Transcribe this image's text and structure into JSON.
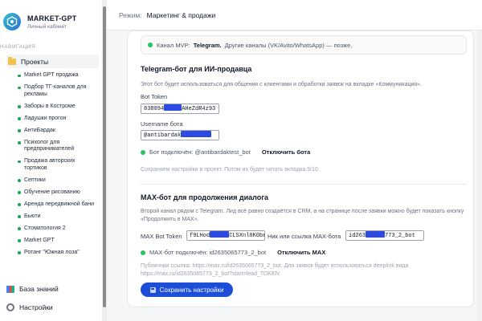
{
  "brand": {
    "title": "MARKET-GPT",
    "subtitle": "Личный кабинет"
  },
  "nav": {
    "heading": "НАВИГАЦИЯ",
    "projects_label": "Проекты",
    "projects": [
      "Market GPT продажа",
      "Подбор ТГ-каналов для рекламы",
      "Заборы в Костроме",
      "Ладушки прогон",
      "АнтиБардак",
      "Психолог для предпринимателей",
      "Продажа авторских тортиков",
      "Септики",
      "Обучение рисованию",
      "Аренда передвижной бани",
      "Бьюти",
      "Стоматология 2",
      "Market GPT",
      "Ротанг \"Южная лоза\""
    ],
    "knowledge_base": "База знаний",
    "settings": "Настройки"
  },
  "topbar": {
    "mode_label": "Режим:",
    "mode_value": "Маркетинг & продажи"
  },
  "notice": {
    "prefix": "Канал MVP:",
    "channel": "Telegram.",
    "suffix": "Другие каналы (VK/Avito/WhatsApp) — позже."
  },
  "telegram": {
    "title": "Telegram-бот для ИИ-продавца",
    "description": "Этот бот будет использоваться для общения с клиентами и обработки заявок на вкладке «Коммуникация».",
    "token_label": "Bot Token",
    "token_start": "838894",
    "token_end": "AHeZdR4z93",
    "username_label": "Username бота",
    "username_start": "@antibardak",
    "status": "Бот подключён: @antibardaktest_bot",
    "disconnect": "Отключить бота",
    "hint": "Сохраняем настройки в проект. Потом их будет читать вкладка 9/10."
  },
  "max": {
    "title": "MAX-бот для продолжения диалога",
    "description": "Второй канал рядом с Telegram. Лид всё равно создаётся в CRM, а на странице после заявки можно будет показать кнопку «Продолжить в MAX».",
    "token_label": "MAX Bot Token",
    "token_start": "f9LHod",
    "token_end": "CLSXnl0K0br",
    "nick_label": "Ник или ссылка MAX-бота",
    "nick_start": "id263",
    "nick_end": "773_2_bot",
    "status": "MAX-бот подключён: id2635065773_2_bot",
    "disconnect": "Отключить MAX",
    "public_link": "Публичная ссылка: https://max.ru/id2635065773_2_bot. Для заявок будет использоваться deeplink вида https://max.ru/id2635065773_2_bot?start=lead_TOKEN"
  },
  "save_button": "Сохранить настройки",
  "colors": {
    "accent": "#1d4ed8",
    "status_green": "#22c55e",
    "redaction": "#2d4be0"
  }
}
